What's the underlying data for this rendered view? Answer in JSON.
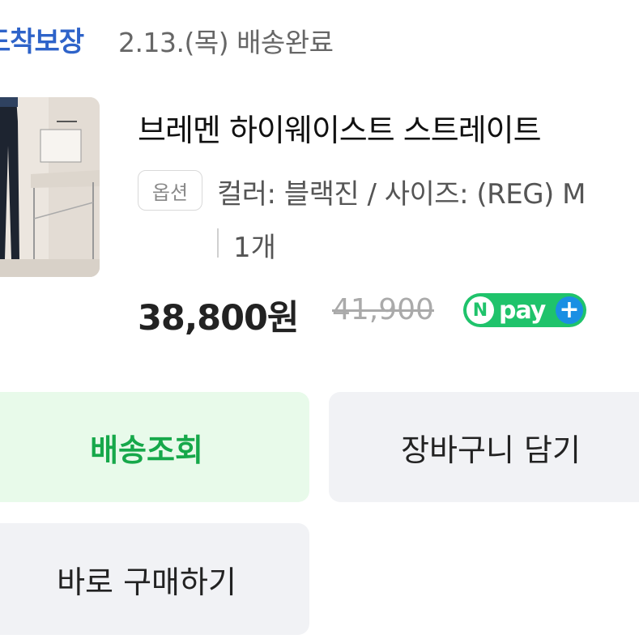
{
  "delivery": {
    "badge": "도착보장",
    "status": "2.13.(목) 배송완료"
  },
  "product": {
    "title": "브레멘 하이웨이스트 스트레이트",
    "option_tag": "옵션",
    "option_text": "컬러: 블랙진 / 사이즈: (REG) M",
    "quantity": "1개",
    "price": "38,800원",
    "original_price": "41,900",
    "npay": {
      "n": "N",
      "text": "pay",
      "plus": "+"
    }
  },
  "actions": {
    "track": "배송조회",
    "cart": "장바구니 담기",
    "buy": "바로 구매하기"
  },
  "colors": {
    "badge": "#2e63c9",
    "npay_green": "#1fc36b",
    "track_bg": "#e8faea",
    "track_text": "#16a84a"
  }
}
